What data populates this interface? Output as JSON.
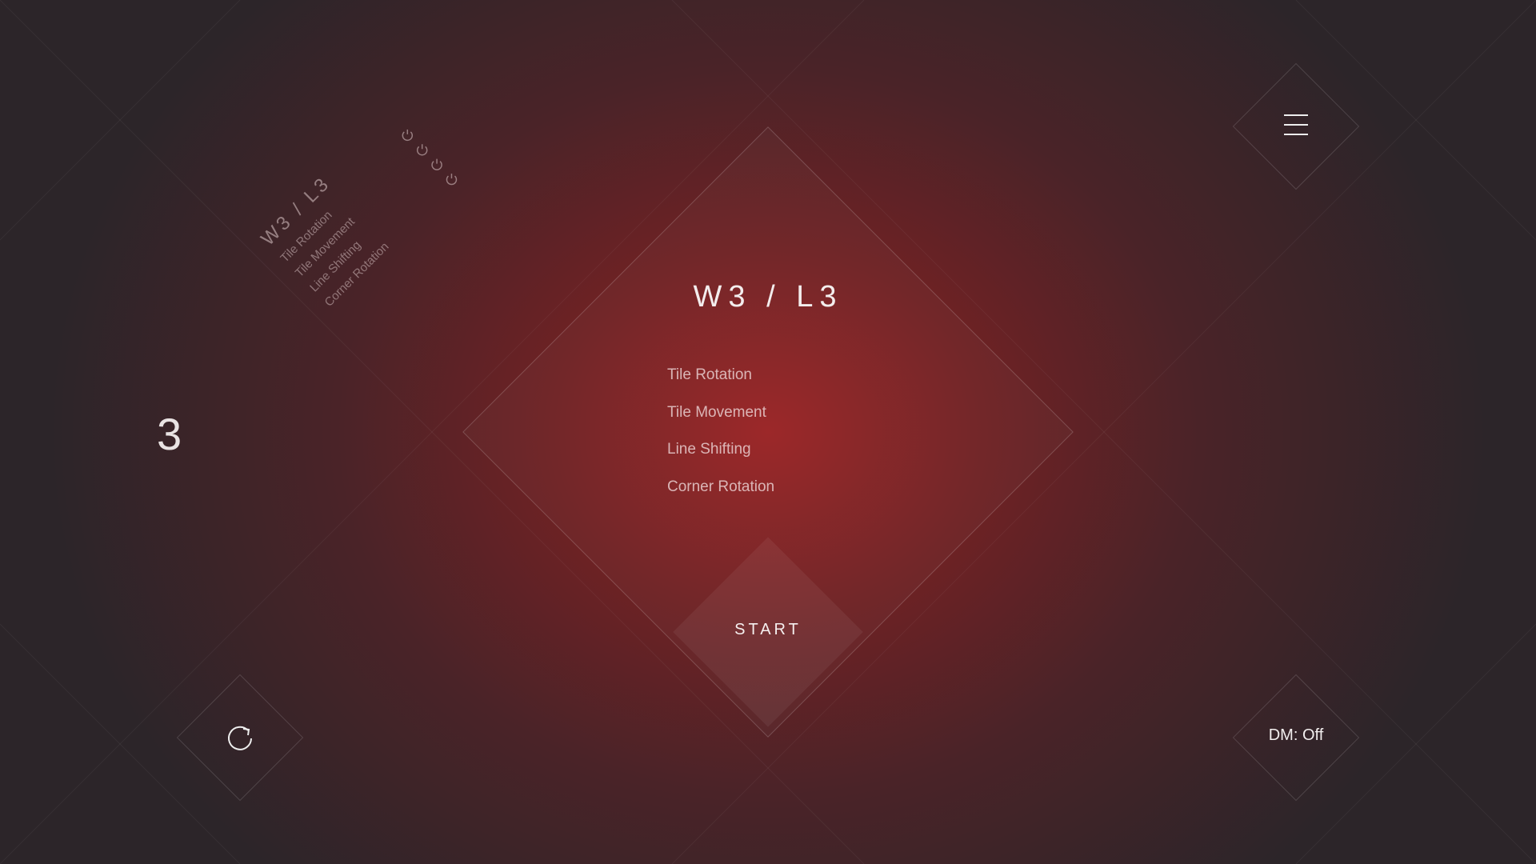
{
  "level": {
    "title": "W3 / L3",
    "mechanics": [
      "Tile Rotation",
      "Tile Movement",
      "Line Shifting",
      "Corner Rotation"
    ]
  },
  "mini_panel": {
    "title": "W3 / L3",
    "items": [
      "Tile Rotation",
      "Tile Movement",
      "Line Shifting",
      "Corner Rotation"
    ],
    "item_icon": "power-icon"
  },
  "start_button": {
    "label": "START"
  },
  "dm_toggle": {
    "label": "DM: Off"
  },
  "world_number": "3",
  "icons": {
    "menu": "hamburger-icon",
    "restart": "refresh-icon"
  },
  "colors": {
    "accent": "#9a2324",
    "background": "#2c2529",
    "text": "#f3eded"
  }
}
